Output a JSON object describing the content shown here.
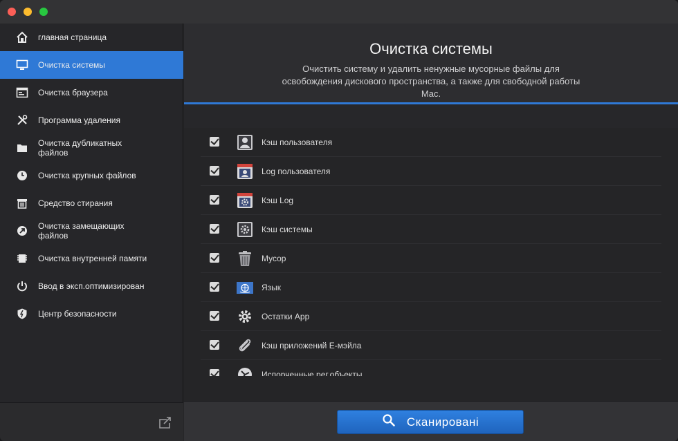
{
  "window": {
    "traffic_lights": [
      "close",
      "minimize",
      "maximize"
    ]
  },
  "sidebar": {
    "items": [
      {
        "label": "главная страница",
        "icon": "home-icon",
        "active": false
      },
      {
        "label": "Очистка системы",
        "icon": "monitor-icon",
        "active": true
      },
      {
        "label": "Очистка браузера",
        "icon": "browser-icon",
        "active": false
      },
      {
        "label": "Программа удаления",
        "icon": "tools-icon",
        "active": false
      },
      {
        "label": "Очистка дубликатных\nфайлов",
        "icon": "folder-icon",
        "active": false
      },
      {
        "label": "Очистка крупных файлов",
        "icon": "clock-icon",
        "active": false
      },
      {
        "label": "Средство стирания",
        "icon": "shredder-icon",
        "active": false
      },
      {
        "label": "Очистка замещающих\nфайлов",
        "icon": "alias-icon",
        "active": false
      },
      {
        "label": "Очистка внутренней памяти",
        "icon": "memory-icon",
        "active": false
      },
      {
        "label": "Ввод в эксп.оптимизирован",
        "icon": "power-icon",
        "active": false
      },
      {
        "label": "Центр безопасности",
        "icon": "shield-icon",
        "active": false
      }
    ],
    "footer_icon": "share-icon"
  },
  "header": {
    "title": "Очистка системы",
    "description": "Очистить систему и удалить ненужные мусорные файлы для освобождения дискового пространства, а также для свободной работы Mac."
  },
  "list": {
    "items": [
      {
        "label": "Кэш пользователя",
        "icon": "user-cache-icon",
        "checked": true
      },
      {
        "label": "Log пользователя",
        "icon": "user-log-icon",
        "checked": true
      },
      {
        "label": "Кэш Log",
        "icon": "log-cache-icon",
        "checked": true
      },
      {
        "label": "Кэш системы",
        "icon": "system-cache-icon",
        "checked": true
      },
      {
        "label": "Мусор",
        "icon": "trash-icon",
        "checked": true
      },
      {
        "label": "Язык",
        "icon": "language-flag-icon",
        "checked": true
      },
      {
        "label": "Остатки App",
        "icon": "gear-icon",
        "checked": true
      },
      {
        "label": "Кэш приложений E-мэйла",
        "icon": "paperclip-icon",
        "checked": true
      },
      {
        "label": "Испорченные рег.объекты",
        "icon": "broken-registry-icon",
        "checked": true
      }
    ]
  },
  "footer": {
    "scan_label": "Сканировані",
    "scan_icon": "search-icon"
  },
  "colors": {
    "accent": "#2f79d6",
    "sidebar_bg": "#262629",
    "main_bg": "#252527"
  }
}
